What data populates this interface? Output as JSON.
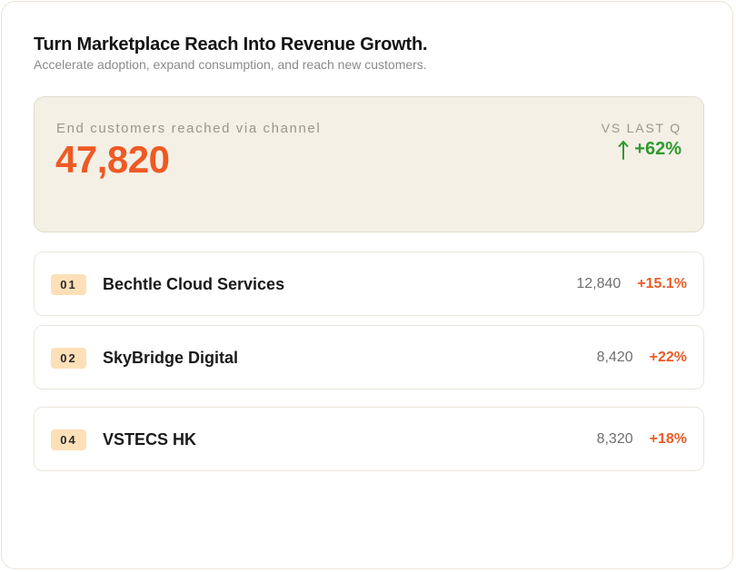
{
  "header": {
    "title": "Turn Marketplace Reach Into Revenue Growth.",
    "subtitle": "Accelerate adoption, expand consumption, and reach new customers."
  },
  "summary": {
    "label": "End customers reached via channel",
    "value": "47,820",
    "compare_label": "VS LAST Q",
    "compare_value": "+62%",
    "compare_icon": "arrow-up-icon",
    "accent_color": "#ee5a24",
    "positive_color": "#2e9a2e"
  },
  "partners": [
    {
      "rank": "01",
      "name": "Bechtle Cloud Services",
      "count": "12,840",
      "change": "+15.1%"
    },
    {
      "rank": "02",
      "name": "SkyBridge Digital",
      "count": "8,420",
      "change": "+22%"
    },
    {
      "rank": "04",
      "name": "VSTECS HK",
      "count": "8,320",
      "change": "+18%"
    }
  ]
}
